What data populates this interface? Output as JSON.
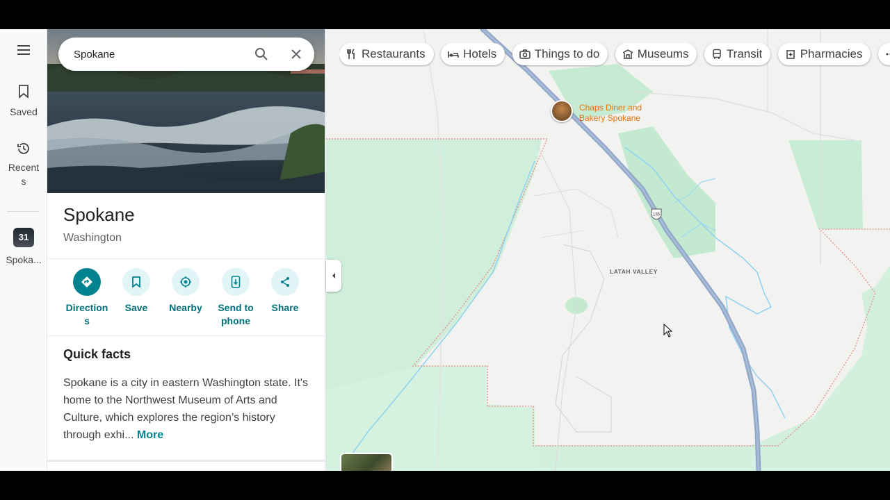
{
  "rail": {
    "saved_label": "Saved",
    "recents_label": "Recent\ns",
    "recent_item_badge": "31",
    "recent_item_label": "Spoka..."
  },
  "search": {
    "value": "Spokane"
  },
  "place": {
    "title": "Spokane",
    "subtitle": "Washington"
  },
  "actions": [
    {
      "label": "Direction\ns",
      "icon": "directions-icon"
    },
    {
      "label": "Save",
      "icon": "bookmark-icon"
    },
    {
      "label": "Nearby",
      "icon": "nearby-icon"
    },
    {
      "label": "Send to\nphone",
      "icon": "send-to-phone-icon"
    },
    {
      "label": "Share",
      "icon": "share-icon"
    }
  ],
  "quick_facts": {
    "title": "Quick facts",
    "body": "Spokane is a city in eastern Washington state. It's home to the Northwest Museum of Arts and Culture, which explores the region’s history through exhi...",
    "more": "More"
  },
  "chips": [
    {
      "label": "Restaurants",
      "icon": "fork-knife-icon"
    },
    {
      "label": "Hotels",
      "icon": "bed-icon"
    },
    {
      "label": "Things to do",
      "icon": "camera-icon"
    },
    {
      "label": "Museums",
      "icon": "museum-icon"
    },
    {
      "label": "Transit",
      "icon": "bus-icon"
    },
    {
      "label": "Pharmacies",
      "icon": "pharmacy-icon"
    }
  ],
  "map": {
    "poi_label": "Chaps Diner and\nBakery Spokane",
    "area_label": "LATAH VALLEY",
    "route_shield": "195"
  },
  "colors": {
    "accent": "#00838f",
    "poi": "#e8710a",
    "park": "#cdeedc",
    "highway": "#8fa6c8",
    "water": "#8ed1f0"
  }
}
